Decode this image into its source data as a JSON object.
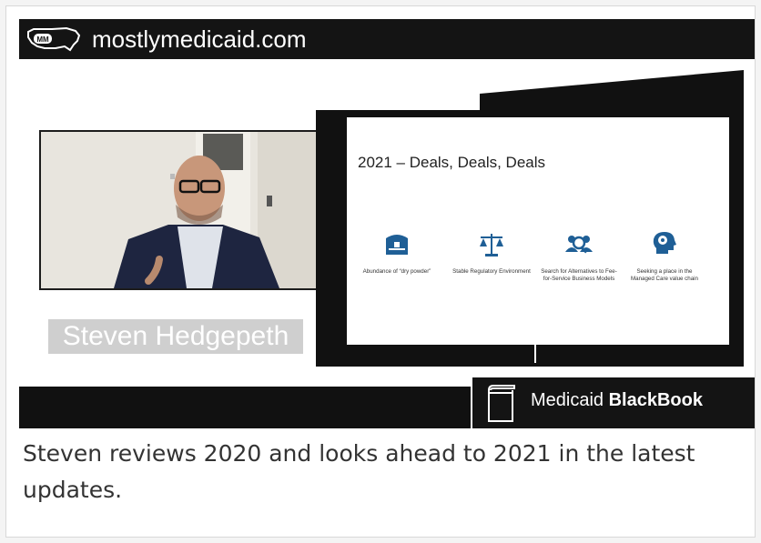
{
  "header": {
    "site": "mostlymedicaid.com",
    "logo_text": "MM"
  },
  "speaker": {
    "name": "Steven Hedgepeth"
  },
  "slide": {
    "title": "2021 – Deals, Deals, Deals",
    "items": [
      {
        "icon": "treasure-chest-icon",
        "label": "Abundance of “dry powder”"
      },
      {
        "icon": "scales-icon",
        "label": "Stable Regulatory Environment"
      },
      {
        "icon": "people-search-icon",
        "label": "Search for Alternatives to Fee-for-Service Business Models"
      },
      {
        "icon": "head-brain-icon",
        "label": "Seeking a place in the Managed Care value chain"
      }
    ]
  },
  "brand": {
    "icon": "book-icon",
    "prefix": "Medicaid ",
    "bold": "BlackBook"
  },
  "caption": "Steven reviews 2020 and looks ahead to 2021 in the latest updates.",
  "colors": {
    "bar": "#141414",
    "icon_blue": "#1f5f96",
    "nameplate": "#cfcfcf"
  }
}
